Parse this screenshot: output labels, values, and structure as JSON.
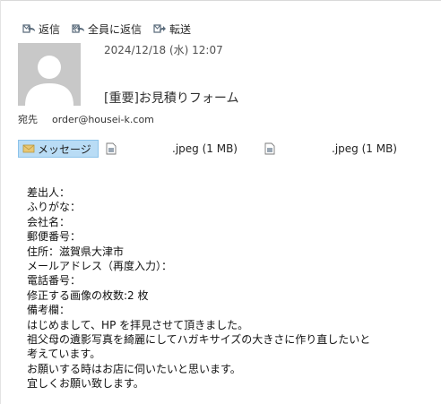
{
  "toolbar": {
    "reply": "返信",
    "reply_all": "全員に返信",
    "forward": "転送"
  },
  "header": {
    "date": "2024/12/18 (水) 12:07",
    "subject": "[重要]お見積りフォーム",
    "to_label": "宛先",
    "to_address": "order@housei-k.com"
  },
  "attachments": {
    "message_tab": "メッセージ",
    "files": [
      {
        "name": ".jpeg (1 MB)"
      },
      {
        "name": ".jpeg (1 MB)"
      }
    ]
  },
  "body": {
    "lines": [
      "差出人：",
      "ふりがな：",
      "会社名：",
      "郵便番号：",
      "住所：滋賀県大津市",
      "メールアドレス（再度入力）：",
      "電話番号：",
      "修正する画像の枚数:2 枚",
      "備考欄：",
      "はじめまして、HP を拝見させて頂きました。",
      "祖父母の遺影写真を綺麗にしてハガキサイズの大きさに作り直したいと",
      "考えています。",
      "お願いする時はお店に伺いたいと思います。",
      "宜しくお願い致します。"
    ]
  },
  "colors": {
    "accent": "#b9dcf5",
    "icon_gray": "#5a6b7b",
    "avatar_bg": "#c8c8c8"
  }
}
